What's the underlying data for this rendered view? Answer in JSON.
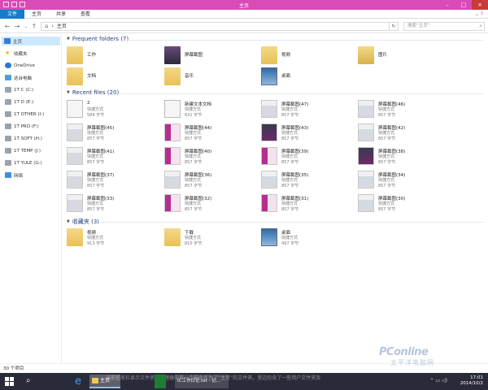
{
  "window": {
    "title": "主页"
  },
  "ribbon": {
    "tabs": [
      "文件",
      "主页",
      "共享",
      "查看"
    ]
  },
  "address": {
    "crumb": "主页",
    "search_placeholder": "搜索“主页”"
  },
  "nav": [
    {
      "label": "主页",
      "icon": "home-icon"
    },
    {
      "label": "收藏夹",
      "icon": "star-icon"
    },
    {
      "label": "OneDrive",
      "icon": "cloud-icon"
    },
    {
      "label": "这台电脑",
      "icon": "pc-icon"
    },
    {
      "label": "1T C (C:)",
      "icon": "drive-icon"
    },
    {
      "label": "1T D (E:)",
      "icon": "drive-icon"
    },
    {
      "label": "1T OTHER (I:)",
      "icon": "drive-icon"
    },
    {
      "label": "1T PRO (F:)",
      "icon": "drive-icon"
    },
    {
      "label": "1T SOFT (H:)",
      "icon": "drive-icon"
    },
    {
      "label": "1T TEMP (J:)",
      "icon": "drive-icon"
    },
    {
      "label": "1T YULE (G:)",
      "icon": "drive-icon"
    },
    {
      "label": "网络",
      "icon": "network-icon"
    }
  ],
  "frequent": {
    "header": "Frequent folders (7)",
    "items": [
      "工作",
      "屏幕截图",
      "视频",
      "图片",
      "文档",
      "音乐",
      "桌面"
    ]
  },
  "recent": {
    "header": "Recent files (20)",
    "items": [
      {
        "name": "2",
        "type": "快捷方式",
        "size": "584 字节"
      },
      {
        "name": "新建文本文档",
        "type": "快捷方式",
        "size": "631 字节"
      },
      {
        "name": "屏幕截图(47)",
        "type": "快捷方式",
        "size": "857 字节"
      },
      {
        "name": "屏幕截图(46)",
        "type": "快捷方式",
        "size": "857 字节"
      },
      {
        "name": "屏幕截图(45)",
        "type": "快捷方式",
        "size": "857 字节"
      },
      {
        "name": "屏幕截图(44)",
        "type": "快捷方式",
        "size": "857 字节"
      },
      {
        "name": "屏幕截图(43)",
        "type": "快捷方式",
        "size": "857 字节"
      },
      {
        "name": "屏幕截图(42)",
        "type": "快捷方式",
        "size": "857 字节"
      },
      {
        "name": "屏幕截图(41)",
        "type": "快捷方式",
        "size": "857 字节"
      },
      {
        "name": "屏幕截图(40)",
        "type": "快捷方式",
        "size": "857 字节"
      },
      {
        "name": "屏幕截图(39)",
        "type": "快捷方式",
        "size": "857 字节"
      },
      {
        "name": "屏幕截图(38)",
        "type": "快捷方式",
        "size": "857 字节"
      },
      {
        "name": "屏幕截图(37)",
        "type": "快捷方式",
        "size": "857 字节"
      },
      {
        "name": "屏幕截图(36)",
        "type": "快捷方式",
        "size": "857 字节"
      },
      {
        "name": "屏幕截图(35)",
        "type": "快捷方式",
        "size": "857 字节"
      },
      {
        "name": "屏幕截图(34)",
        "type": "快捷方式",
        "size": "857 字节"
      },
      {
        "name": "屏幕截图(33)",
        "type": "快捷方式",
        "size": "857 字节"
      },
      {
        "name": "屏幕截图(32)",
        "type": "快捷方式",
        "size": "857 字节"
      },
      {
        "name": "屏幕截图(31)",
        "type": "快捷方式",
        "size": "857 字节"
      },
      {
        "name": "屏幕截图(30)",
        "type": "快捷方式",
        "size": "857 字节"
      }
    ]
  },
  "favorites": {
    "header": "收藏夹 (3)",
    "items": [
      {
        "name": "视频",
        "type": "快捷方式",
        "size": "913 字节"
      },
      {
        "name": "下载",
        "type": "快捷方式",
        "size": "810 字节"
      },
      {
        "name": "桌面",
        "type": "快捷方式",
        "size": "497 字节"
      }
    ]
  },
  "status": {
    "count": "30 个项目"
  },
  "taskbar": {
    "explorer_label": "主页",
    "word_label": "IC工作日记.txt - 记...",
    "caption": "当前任务栏显示文件资源管理器中有一个被命名为了“主页”的文件夹，里边包含了一些用户文件夹及",
    "time": "17:01",
    "date": "2014/10/2"
  },
  "watermark": {
    "brand": "PConline",
    "sub": "太平洋电脑网"
  },
  "colors": {
    "titlebar": "#d94bb7",
    "file_tab": "#1979ca",
    "taskbar": "#2a2b3a",
    "section_header": "#1e3d7a"
  }
}
